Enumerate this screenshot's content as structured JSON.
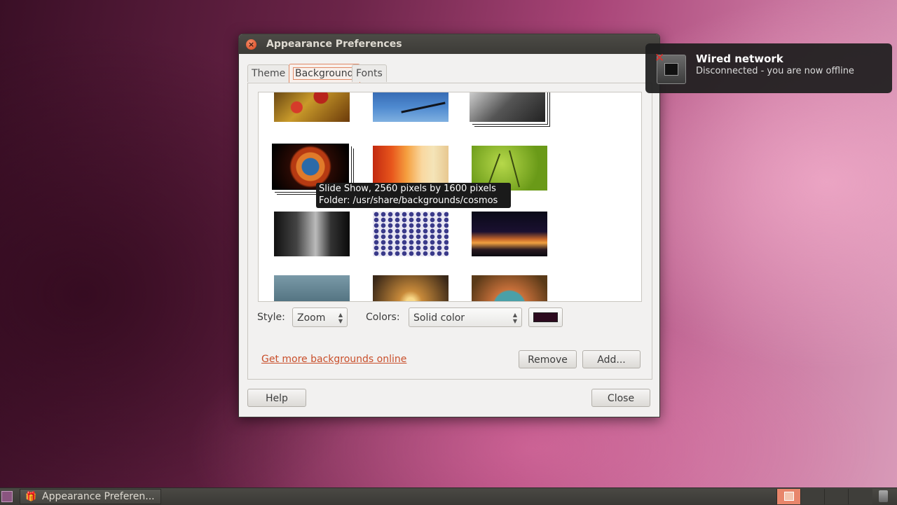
{
  "window": {
    "title": "Appearance Preferences",
    "tabs": [
      {
        "label": "Theme"
      },
      {
        "label": "Background",
        "active": true
      },
      {
        "label": "Fonts"
      }
    ],
    "tooltip": {
      "line1": "Slide Show, 2560 pixels by 1600 pixels",
      "line2": "Folder: /usr/share/backgrounds/cosmos"
    },
    "style_label": "Style:",
    "style_value": "Zoom",
    "colors_label": "Colors:",
    "colors_value": "Solid color",
    "color_swatch": "#2c0a1e",
    "more_link": "Get more backgrounds online",
    "remove_label": "Remove",
    "add_label": "Add...",
    "help_label": "Help",
    "close_label": "Close"
  },
  "notification": {
    "title": "Wired network",
    "body": "Disconnected - you are now offline"
  },
  "panel": {
    "task_label": "Appearance Preferen..."
  },
  "colors": {
    "accent": "#e0875f",
    "link": "#c94f2b"
  }
}
